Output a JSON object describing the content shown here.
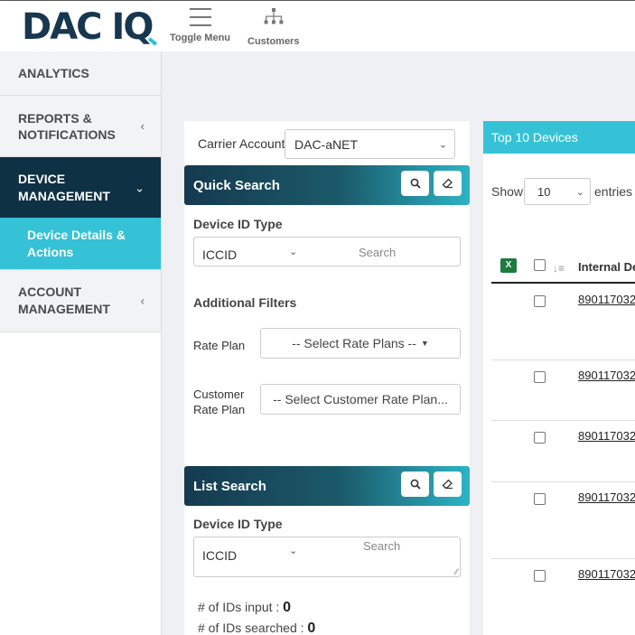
{
  "header": {
    "logo_text": "DAC IQ",
    "toggle_menu_label": "Toggle Menu",
    "customers_label": "Customers"
  },
  "sidebar": {
    "items": [
      {
        "label": "ANALYTICS"
      },
      {
        "label": "REPORTS & NOTIFICATIONS"
      },
      {
        "label": "DEVICE MANAGEMENT"
      },
      {
        "label": "Device Details & Actions"
      },
      {
        "label": "ACCOUNT MANAGEMENT"
      }
    ]
  },
  "search_panel": {
    "carrier_account_label": "Carrier Account",
    "carrier_account_value": "DAC-aNET",
    "quick_search": {
      "title": "Quick Search",
      "device_id_type_label": "Device ID Type",
      "device_id_type_value": "ICCID",
      "search_placeholder": "Search",
      "additional_filters_label": "Additional Filters",
      "rate_plan_label": "Rate Plan",
      "rate_plan_button": "-- Select Rate Plans --",
      "customer_rate_plan_label_line1": "Customer",
      "customer_rate_plan_label_line2": "Rate Plan",
      "customer_rate_plan_button": "-- Select Customer Rate Plan..."
    },
    "list_search": {
      "title": "List Search",
      "device_id_type_label": "Device ID Type",
      "device_id_type_value": "ICCID",
      "search_placeholder": "Search",
      "ids_input_label": "# of IDs input : ",
      "ids_input_value": "0",
      "ids_searched_label": "# of IDs searched : ",
      "ids_searched_value": "0"
    }
  },
  "devices_panel": {
    "title": "Top 10 Devices",
    "show_label": "Show",
    "entries_value": "10",
    "entries_label": "entries",
    "column_header": "Internal De",
    "rows": [
      {
        "id": "890117032"
      },
      {
        "id": "890117032"
      },
      {
        "id": "890117032"
      },
      {
        "id": "890117032"
      },
      {
        "id": "890117032"
      }
    ]
  }
}
